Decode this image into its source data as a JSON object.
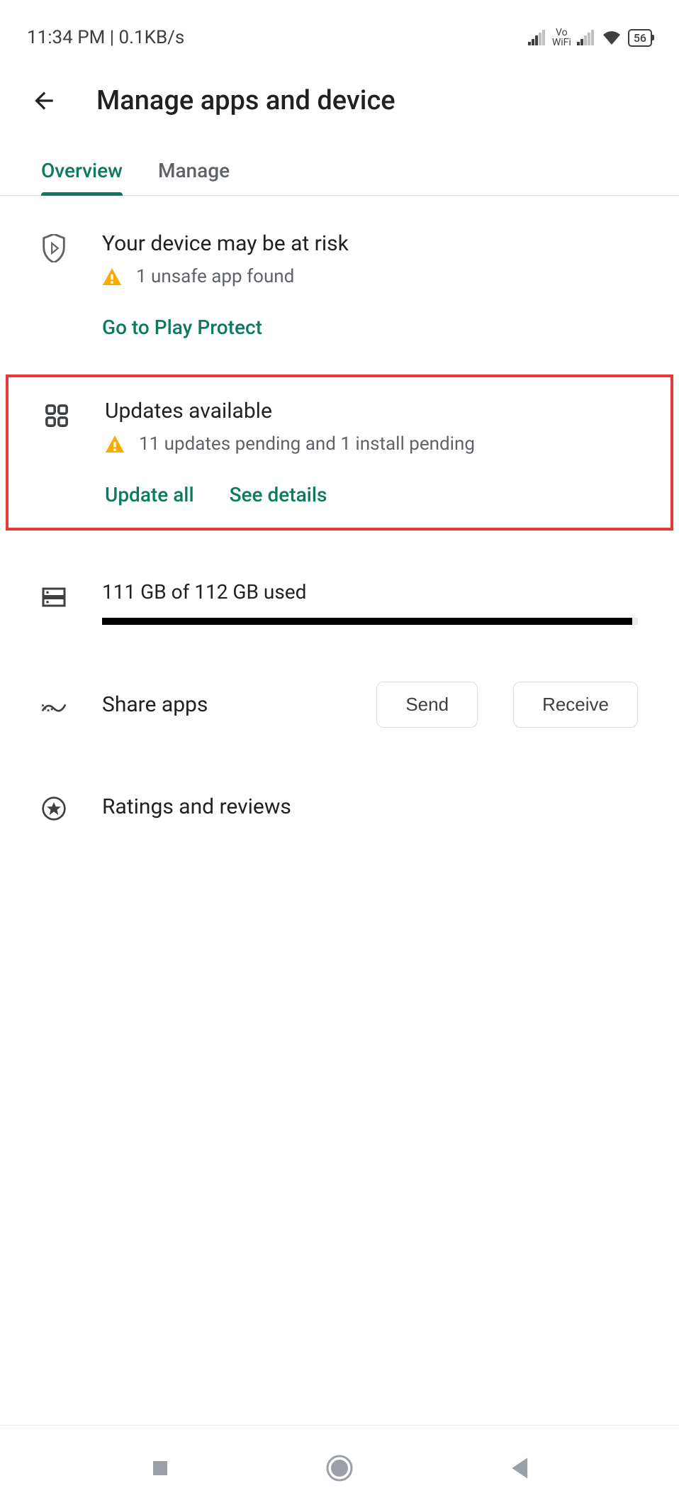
{
  "status_bar": {
    "time": "11:34 PM",
    "data_rate": "0.1KB/s",
    "vowifi_top": "Vo",
    "vowifi_bottom": "WiFi",
    "battery": "56"
  },
  "header": {
    "title": "Manage apps and device"
  },
  "tabs": {
    "overview": "Overview",
    "manage": "Manage"
  },
  "protect": {
    "title": "Your device may be at risk",
    "subtitle": "1 unsafe app found",
    "action": "Go to Play Protect"
  },
  "updates": {
    "title": "Updates available",
    "subtitle": "11 updates pending and 1 install pending",
    "update_all": "Update all",
    "see_details": "See details"
  },
  "storage": {
    "text": "111 GB of 112 GB used",
    "fill_percent": 99
  },
  "share": {
    "label": "Share apps",
    "send": "Send",
    "receive": "Receive"
  },
  "ratings": {
    "label": "Ratings and reviews"
  }
}
